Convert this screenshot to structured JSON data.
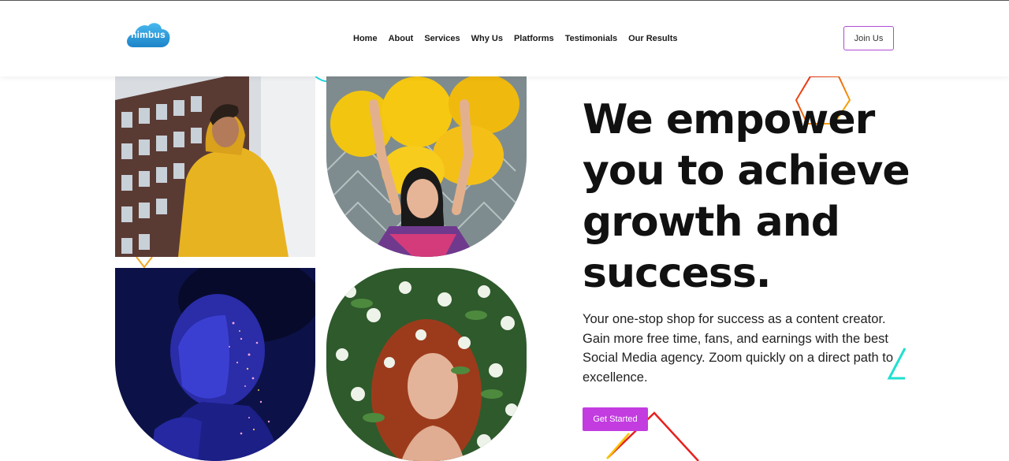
{
  "brand": {
    "logo_text": "nimbus",
    "accent": "#c23ce0",
    "logo_color": "#2b9bd8"
  },
  "nav": {
    "items": [
      "Home",
      "About",
      "Services",
      "Why Us",
      "Platforms",
      "Testimonials",
      "Our Results"
    ]
  },
  "header": {
    "join_label": "Join Us"
  },
  "hero": {
    "title": "We empower you to achieve growth and success.",
    "description": "Your one-stop shop for success as a content creator. Gain more free time, fans, and earnings with the best Social Media agency. Zoom quickly on a direct path to excellence.",
    "cta_label": "Get Started"
  },
  "gallery": {
    "images": [
      {
        "subject": "man-in-yellow-hoodie"
      },
      {
        "subject": "girl-with-yellow-balloons"
      },
      {
        "subject": "woman-with-glitter-blue-light"
      },
      {
        "subject": "red-haired-woman-in-flowers"
      }
    ]
  },
  "decorations": {
    "colors": [
      "#1fd6e0",
      "#f5a623",
      "#e8201c",
      "#f7c300"
    ]
  }
}
